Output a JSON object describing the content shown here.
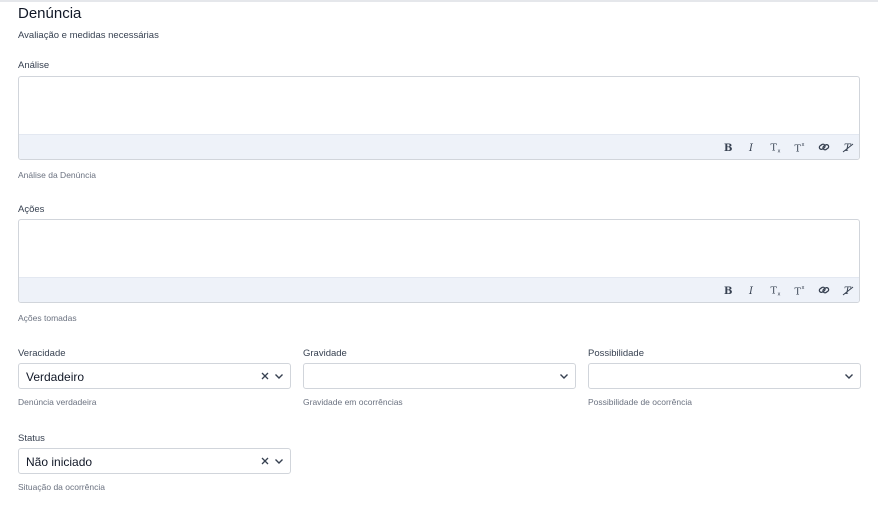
{
  "header": {
    "title": "Denúncia",
    "subtitle": "Avaliação e medidas necessárias"
  },
  "analise": {
    "label": "Análise",
    "help": "Análise da Denúncia",
    "value": ""
  },
  "acoes": {
    "label": "Ações",
    "help": "Ações tomadas",
    "value": ""
  },
  "editor_toolbar": [
    "bold-icon",
    "italic-icon",
    "subscript-icon",
    "superscript-icon",
    "link-icon",
    "clear-format-icon"
  ],
  "veracidade": {
    "label": "Veracidade",
    "value": "Verdadeiro",
    "help": "Denúncia verdadeira"
  },
  "gravidade": {
    "label": "Gravidade",
    "value": "",
    "help": "Gravidade em ocorrências"
  },
  "possibilidade": {
    "label": "Possibilidade",
    "value": "",
    "help": "Possibilidade de ocorrência"
  },
  "status": {
    "label": "Status",
    "value": "Não iniciado",
    "help": "Situação da ocorrência"
  },
  "colors": {
    "toolbar_bg": "#eef2f9",
    "border": "#d1d5db",
    "text": "#111827",
    "muted": "#6b7280"
  }
}
